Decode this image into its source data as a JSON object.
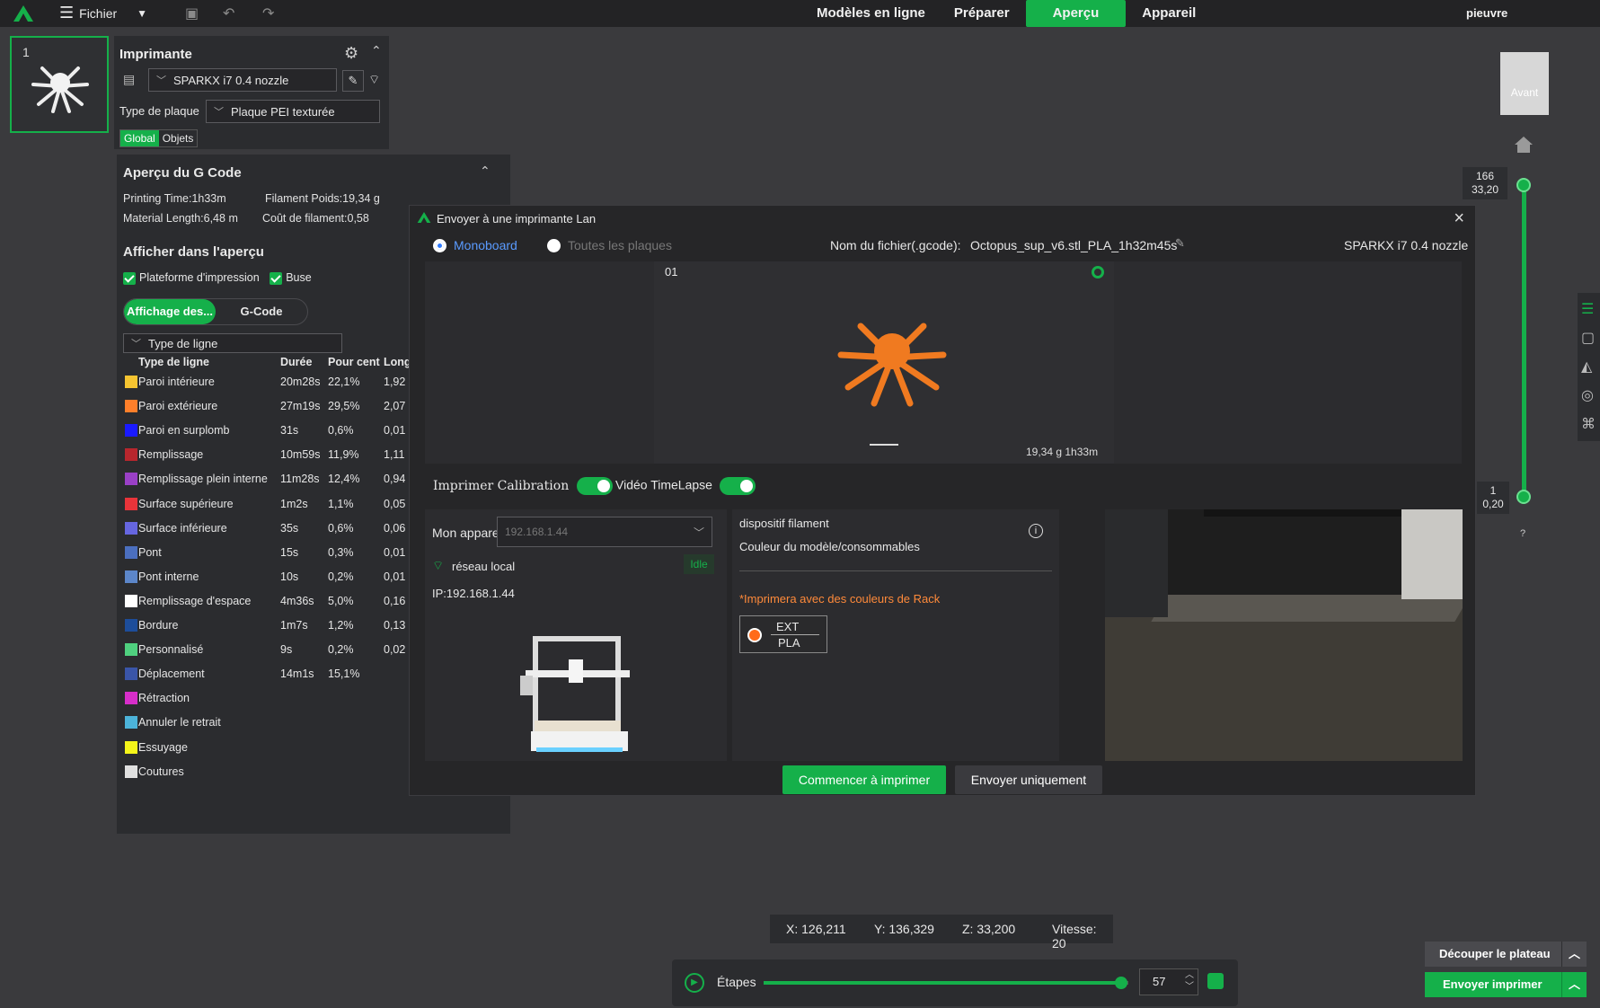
{
  "topbar": {
    "file_menu": "Fichier",
    "tabs": [
      "Modèles en ligne",
      "Préparer",
      "Aperçu",
      "Appareil"
    ],
    "active_tab": "Aperçu",
    "user": "pieuvre"
  },
  "plate": {
    "number": "1"
  },
  "printer_panel": {
    "title": "Imprimante",
    "printer": "SPARKX i7 0.4 nozzle",
    "plate_type_label": "Type de plaque",
    "plate_type": "Plaque PEI texturée",
    "scope_tabs": [
      "Global",
      "Objets"
    ]
  },
  "gcode": {
    "title": "Aperçu du G Code",
    "printing_time": "Printing Time:1h33m",
    "filament_weight": "Filament Poids:19,34 g",
    "material_length": "Material Length:6,48 m",
    "filament_cost": "Coût de filament:0,58",
    "show_title": "Afficher dans l'aperçu",
    "chk_platform": "Plateforme d'impression",
    "chk_nozzle": "Buse",
    "view_tabs": [
      "Affichage des...",
      "G-Code"
    ],
    "line_type_select": "Type de ligne",
    "columns": [
      "Type de ligne",
      "Durée",
      "Pour cent",
      "Long"
    ],
    "rows": [
      {
        "name": "Paroi intérieure",
        "time": "20m28s",
        "pct": "22,1%",
        "len": "1,92",
        "color": "#f5c431"
      },
      {
        "name": "Paroi extérieure",
        "time": "27m19s",
        "pct": "29,5%",
        "len": "2,07",
        "color": "#ff7f2a"
      },
      {
        "name": "Paroi en surplomb",
        "time": "31s",
        "pct": "0,6%",
        "len": "0,01",
        "color": "#1a1aff"
      },
      {
        "name": "Remplissage",
        "time": "10m59s",
        "pct": "11,9%",
        "len": "1,11",
        "color": "#b8262d"
      },
      {
        "name": "Remplissage plein interne",
        "time": "11m28s",
        "pct": "12,4%",
        "len": "0,94",
        "color": "#9a40c6"
      },
      {
        "name": "Surface supérieure",
        "time": "1m2s",
        "pct": "1,1%",
        "len": "0,05",
        "color": "#e8343a"
      },
      {
        "name": "Surface inférieure",
        "time": "35s",
        "pct": "0,6%",
        "len": "0,06",
        "color": "#6666e0"
      },
      {
        "name": "Pont",
        "time": "15s",
        "pct": "0,3%",
        "len": "0,01",
        "color": "#4b6fbf"
      },
      {
        "name": "Pont interne",
        "time": "10s",
        "pct": "0,2%",
        "len": "0,01",
        "color": "#5c86c9"
      },
      {
        "name": "Remplissage d'espace",
        "time": "4m36s",
        "pct": "5,0%",
        "len": "0,16",
        "color": "#ffffff"
      },
      {
        "name": "Bordure",
        "time": "1m7s",
        "pct": "1,2%",
        "len": "0,13",
        "color": "#1d4d9a"
      },
      {
        "name": "Personnalisé",
        "time": "9s",
        "pct": "0,2%",
        "len": "0,02",
        "color": "#4fd07f"
      },
      {
        "name": "Déplacement",
        "time": "14m1s",
        "pct": "15,1%",
        "len": "",
        "color": "#3a55a8"
      },
      {
        "name": "Rétraction",
        "time": "",
        "pct": "",
        "len": "",
        "color": "#d72ec9"
      },
      {
        "name": "Annuler le retrait",
        "time": "",
        "pct": "",
        "len": "",
        "color": "#4cb3d9"
      },
      {
        "name": "Essuyage",
        "time": "",
        "pct": "",
        "len": "",
        "color": "#f5f51a"
      },
      {
        "name": "Coutures",
        "time": "",
        "pct": "",
        "len": "",
        "color": "#e0e0e0"
      }
    ]
  },
  "view": {
    "cube_label": "Avant",
    "layer_top": "166",
    "layer_top_z": "33,20",
    "layer_bottom": "1",
    "layer_bottom_z": "0,20",
    "help": "?"
  },
  "dialog": {
    "title": "Envoyer à une imprimante Lan",
    "radio_mono": "Monoboard",
    "radio_all": "Toutes les plaques",
    "filename_label": "Nom du fichier(.gcode):",
    "filename": "Octopus_sup_v6.stl_PLA_1h32m45s",
    "printer": "SPARKX i7 0.4 nozzle",
    "plate_num": "01",
    "plate_stats": "19,34 g  1h33m",
    "calibration_label": "Imprimer Calibration",
    "timelapse_label": "Vidéo TimeLapse",
    "device_label": "Mon appareil",
    "device_ip_select": "192.168.1.44",
    "network": "réseau local",
    "status": "Idle",
    "ip": "IP:192.168.1.44",
    "filament_title": "dispositif filament",
    "filament_sub": "Couleur du modèle/consommables",
    "rack_note": "*Imprimera avec des couleurs de Rack",
    "ext_label": "EXT",
    "ext_material": "PLA",
    "btn_start": "Commencer à imprimer",
    "btn_send": "Envoyer uniquement"
  },
  "status": {
    "x": "X: 126,211",
    "y": "Y: 136,329",
    "z": "Z: 33,200",
    "speed": "Vitesse: 20",
    "steps_label": "Étapes",
    "step_value": "57",
    "step_progress": 0.98
  },
  "actions": {
    "slice_plate": "Découper le plateau",
    "send_print": "Envoyer imprimer"
  }
}
